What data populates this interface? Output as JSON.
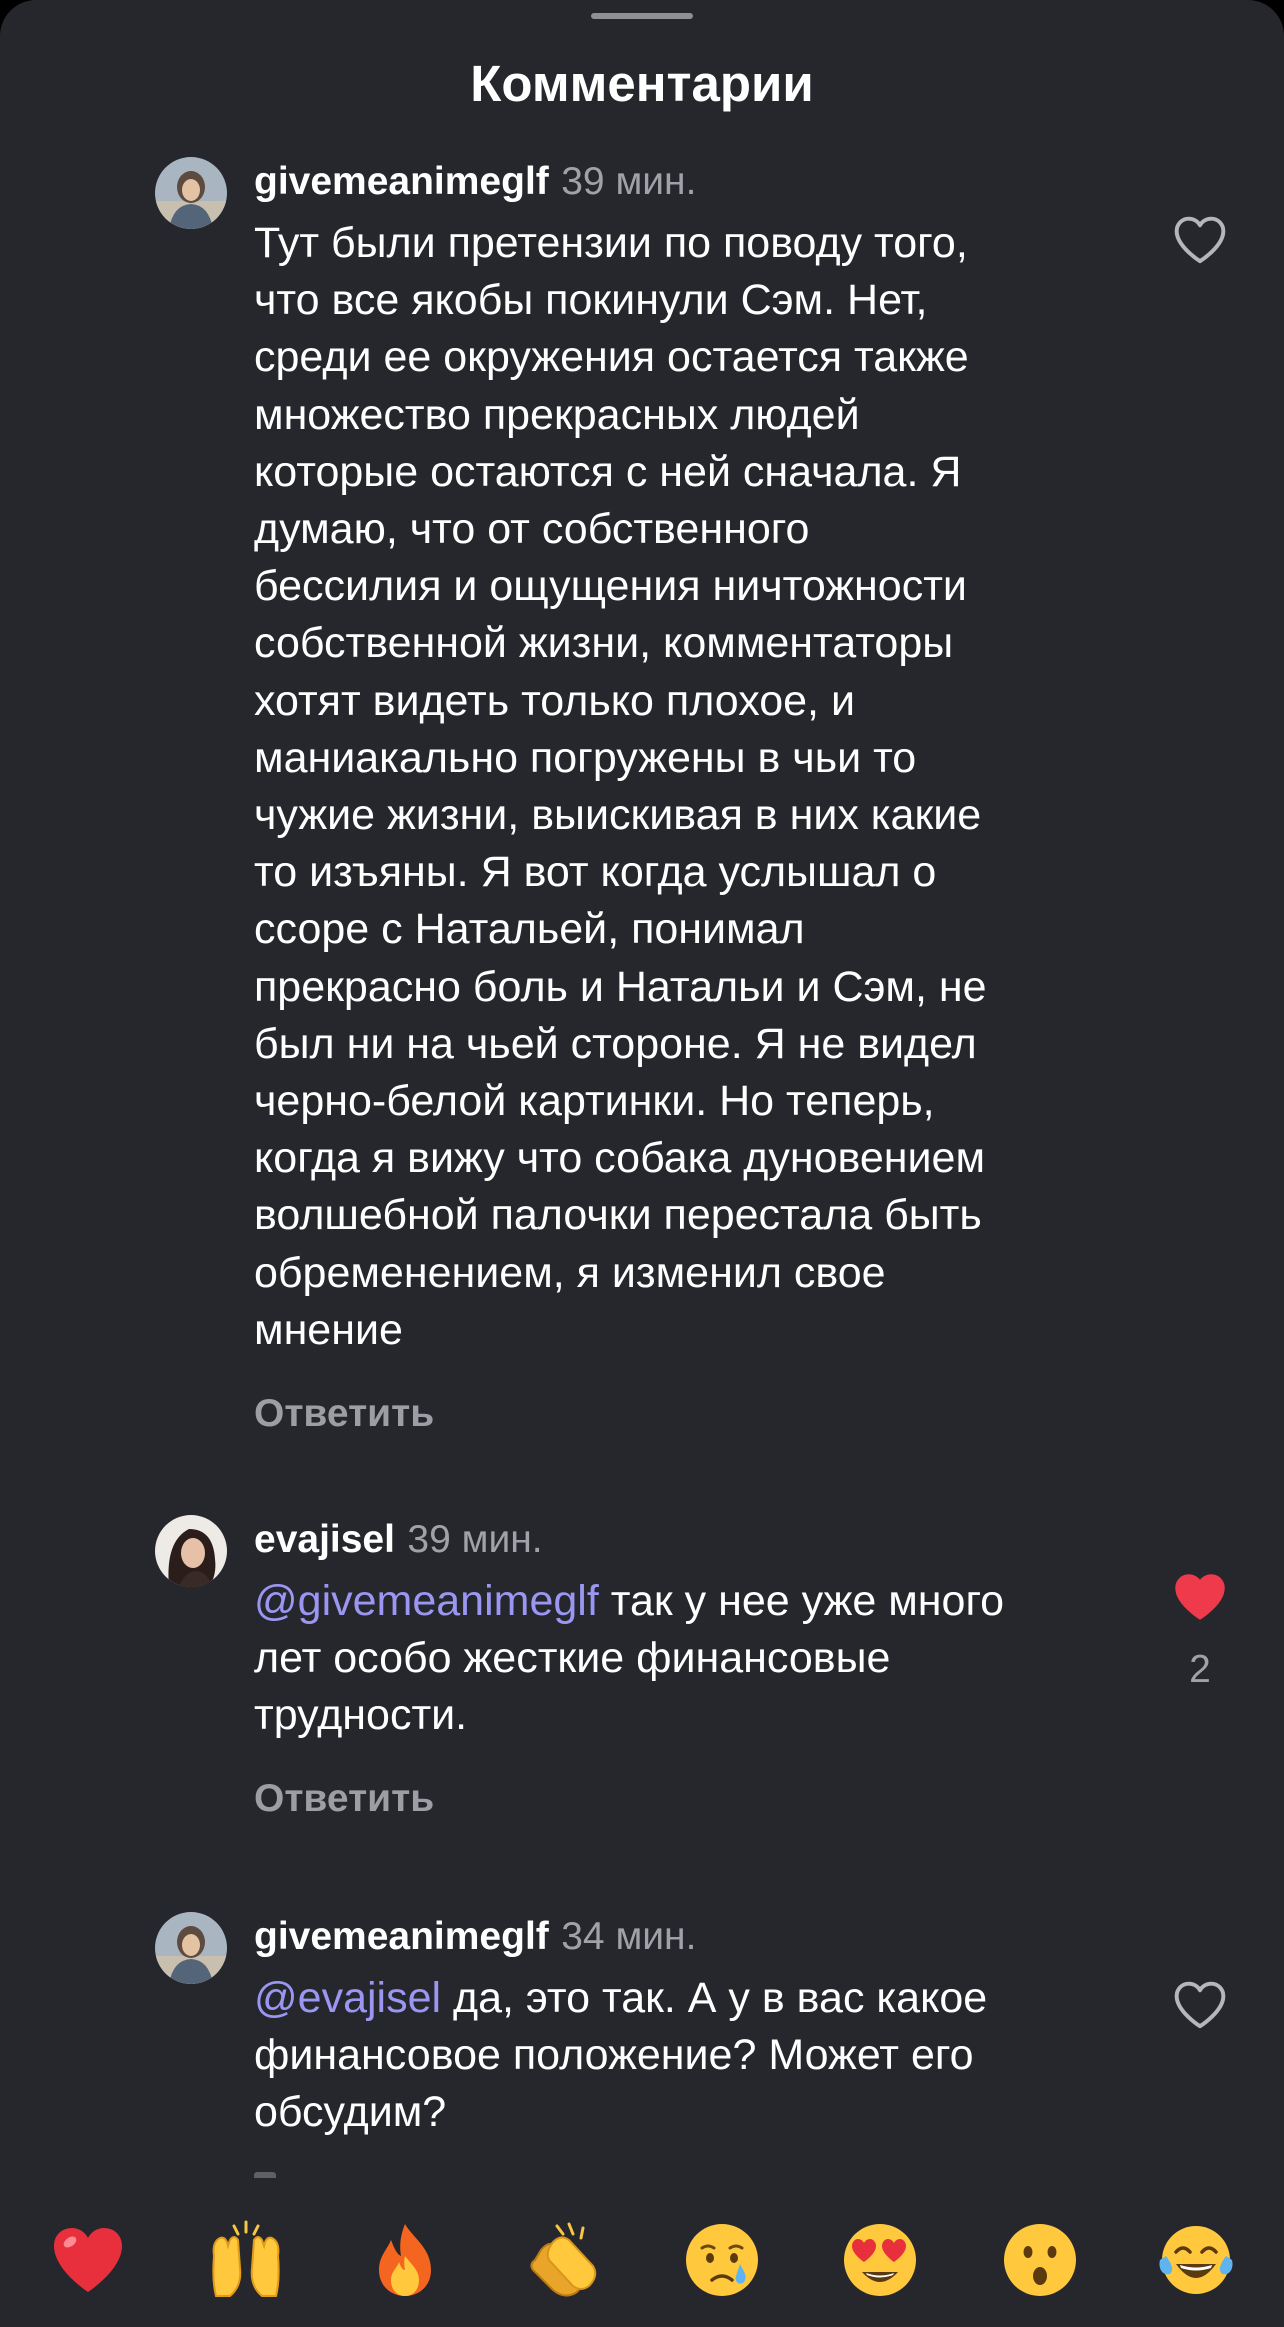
{
  "header": {
    "title": "Комментарии"
  },
  "comments": [
    {
      "username": "givemeanimeglf",
      "time": "39 мин.",
      "lines": [
        "Тут были претензии по поводу того,",
        "что все якобы покинули Сэм. Нет,",
        "среди ее окружения остается также",
        "множество прекрасных людей",
        "которые остаются с ней сначала. Я",
        "думаю, что от собственного",
        "бессилия и ощущения ничтожности",
        "собственной жизни, комментаторы",
        "хотят видеть только плохое, и",
        "маниакально погружены в чьи то",
        "чужие жизни, выискивая в них какие",
        "то изъяны. Я вот когда услышал о",
        "ссоре с Натальей, понимал",
        "прекрасно боль и Натальи и Сэм, не",
        "был ни на чьей стороне. Я не видел",
        "черно-белой картинки. Но теперь,",
        "когда я вижу что собака дуновением",
        "волшебной палочки перестала быть",
        "обременением, я изменил свое",
        "мнение"
      ],
      "reply_label": "Ответить",
      "liked": false
    },
    {
      "username": "evajisel",
      "time": "39 мин.",
      "mention": "@givemeanimeglf",
      "lines": [
        " так у нее уже много",
        "лет особо жесткие финансовые",
        "трудности."
      ],
      "reply_label": "Ответить",
      "liked": true,
      "like_count": "2"
    },
    {
      "username": "givemeanimeglf",
      "time": "34 мин.",
      "mention": "@evajisel",
      "lines": [
        " да, это так. А у в вас какое",
        "финансовое положение? Может его",
        "обсудим?"
      ],
      "liked": false
    }
  ],
  "emoji_bar": {
    "emojis": [
      "heart",
      "raising-hands",
      "fire",
      "clapping-hands",
      "crying-face",
      "heart-eyes-face",
      "surprised-face",
      "tears-of-joy-face"
    ]
  },
  "colors": {
    "background": "#25272d",
    "mention": "#9b96f2",
    "like_active": "#ee3a4a",
    "secondary_text": "#a0a2a8"
  }
}
